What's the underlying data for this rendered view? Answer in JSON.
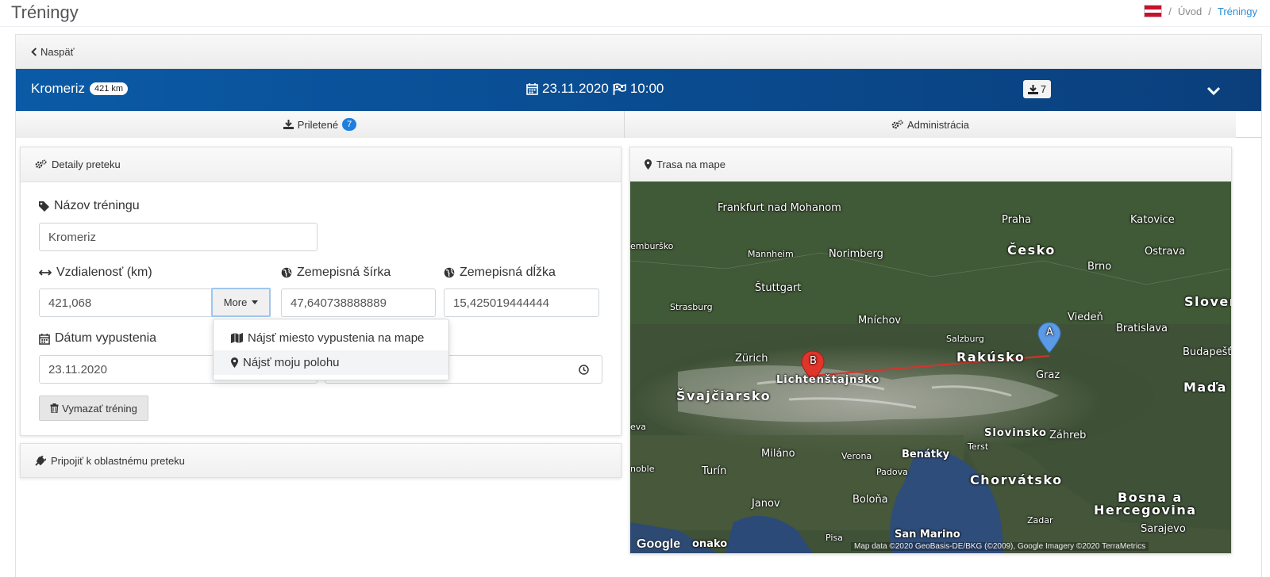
{
  "header": {
    "title": "Tréningy",
    "breadcrumbs": [
      {
        "label": "Úvod"
      },
      {
        "label": "Tréningy"
      }
    ],
    "separator": "/"
  },
  "back": {
    "label": "Naspäť"
  },
  "race": {
    "name": "Kromeriz",
    "distance_badge": "421 km",
    "date": "23.11.2020",
    "time": "10:00",
    "arrivals_count": "7"
  },
  "tabs": [
    {
      "label": "Priletené",
      "badge": "7"
    },
    {
      "label": "Administrácia"
    }
  ],
  "details": {
    "title": "Detaily preteku",
    "name_label": "Názov tréningu",
    "name_value": "Kromeriz",
    "distance_label": "Vzdialenosť (km)",
    "distance_value": "421,068",
    "more_label": "More",
    "lat_label": "Zemepisná šírka",
    "lat_value": "47,640738888889",
    "lon_label": "Zemepisná dĺžka",
    "lon_value": "15,425019444444",
    "date_label": "Dátum vypustenia",
    "date_value": "23.11.2020",
    "delete_label": "Vymazať tréning"
  },
  "dropdown": {
    "items": [
      {
        "label": "Nájsť miesto vypustenia na mape"
      },
      {
        "label": "Nájsť moju polohu"
      }
    ]
  },
  "join": {
    "label": "Pripojiť k oblastnému preteku"
  },
  "map_panel": {
    "title": "Trasa na mape",
    "markers": [
      {
        "label": "A"
      },
      {
        "label": "B"
      }
    ],
    "places": {
      "frankfurt": "Frankfurt nad Mohanom",
      "praha": "Praha",
      "katovice": "Katovice",
      "cesko": "Česko",
      "wurzburg": "emburško",
      "mannheim": "Mannheim",
      "norimberg": "Norimberg",
      "brno": "Brno",
      "ostrava": "Ostrava",
      "stuttgart": "Štuttgart",
      "slovensko": "Sloven",
      "strasburg": "Strasburg",
      "mnichov": "Mníchov",
      "vieden": "Viedeň",
      "bratislava": "Bratislava",
      "salzburg": "Salzburg",
      "budapest": "Budapešť",
      "zurich": "Zürich",
      "rakusko": "Rakúsko",
      "graz": "Graz",
      "lichtenstajnsko": "Lichtenštajnsko",
      "svajciarsko": "Švajčiarsko",
      "madarsko": "Maďa",
      "zeneva": "eva",
      "slovinsko": "Slovinsko",
      "zahreb": "Záhreb",
      "terst": "Terst",
      "milano": "Miláno",
      "verona": "Verona",
      "benatky": "Benátky",
      "turin": "Turín",
      "padova": "Padova",
      "grenoble": "noble",
      "chorvatsko": "Chorvátsko",
      "janov": "Janov",
      "bolona": "Boloňa",
      "bosna": "Bosna a",
      "hercegovina": "Hercegovina",
      "zadar": "Zadar",
      "sarajevo": "Sarajevo",
      "sanmarino": "San Marino",
      "pisa": "Pisa",
      "monako": "onako"
    },
    "google": "Google",
    "attribution": "Map data ©2020 GeoBasis-DE/BKG (©2009), Google Imagery ©2020 TerraMetrics"
  },
  "colors": {
    "primary_blue": "#0b4f97",
    "badge_blue": "#1e7fe0",
    "route_red": "#e0302a",
    "marker_blue": "#5b9ae6"
  }
}
